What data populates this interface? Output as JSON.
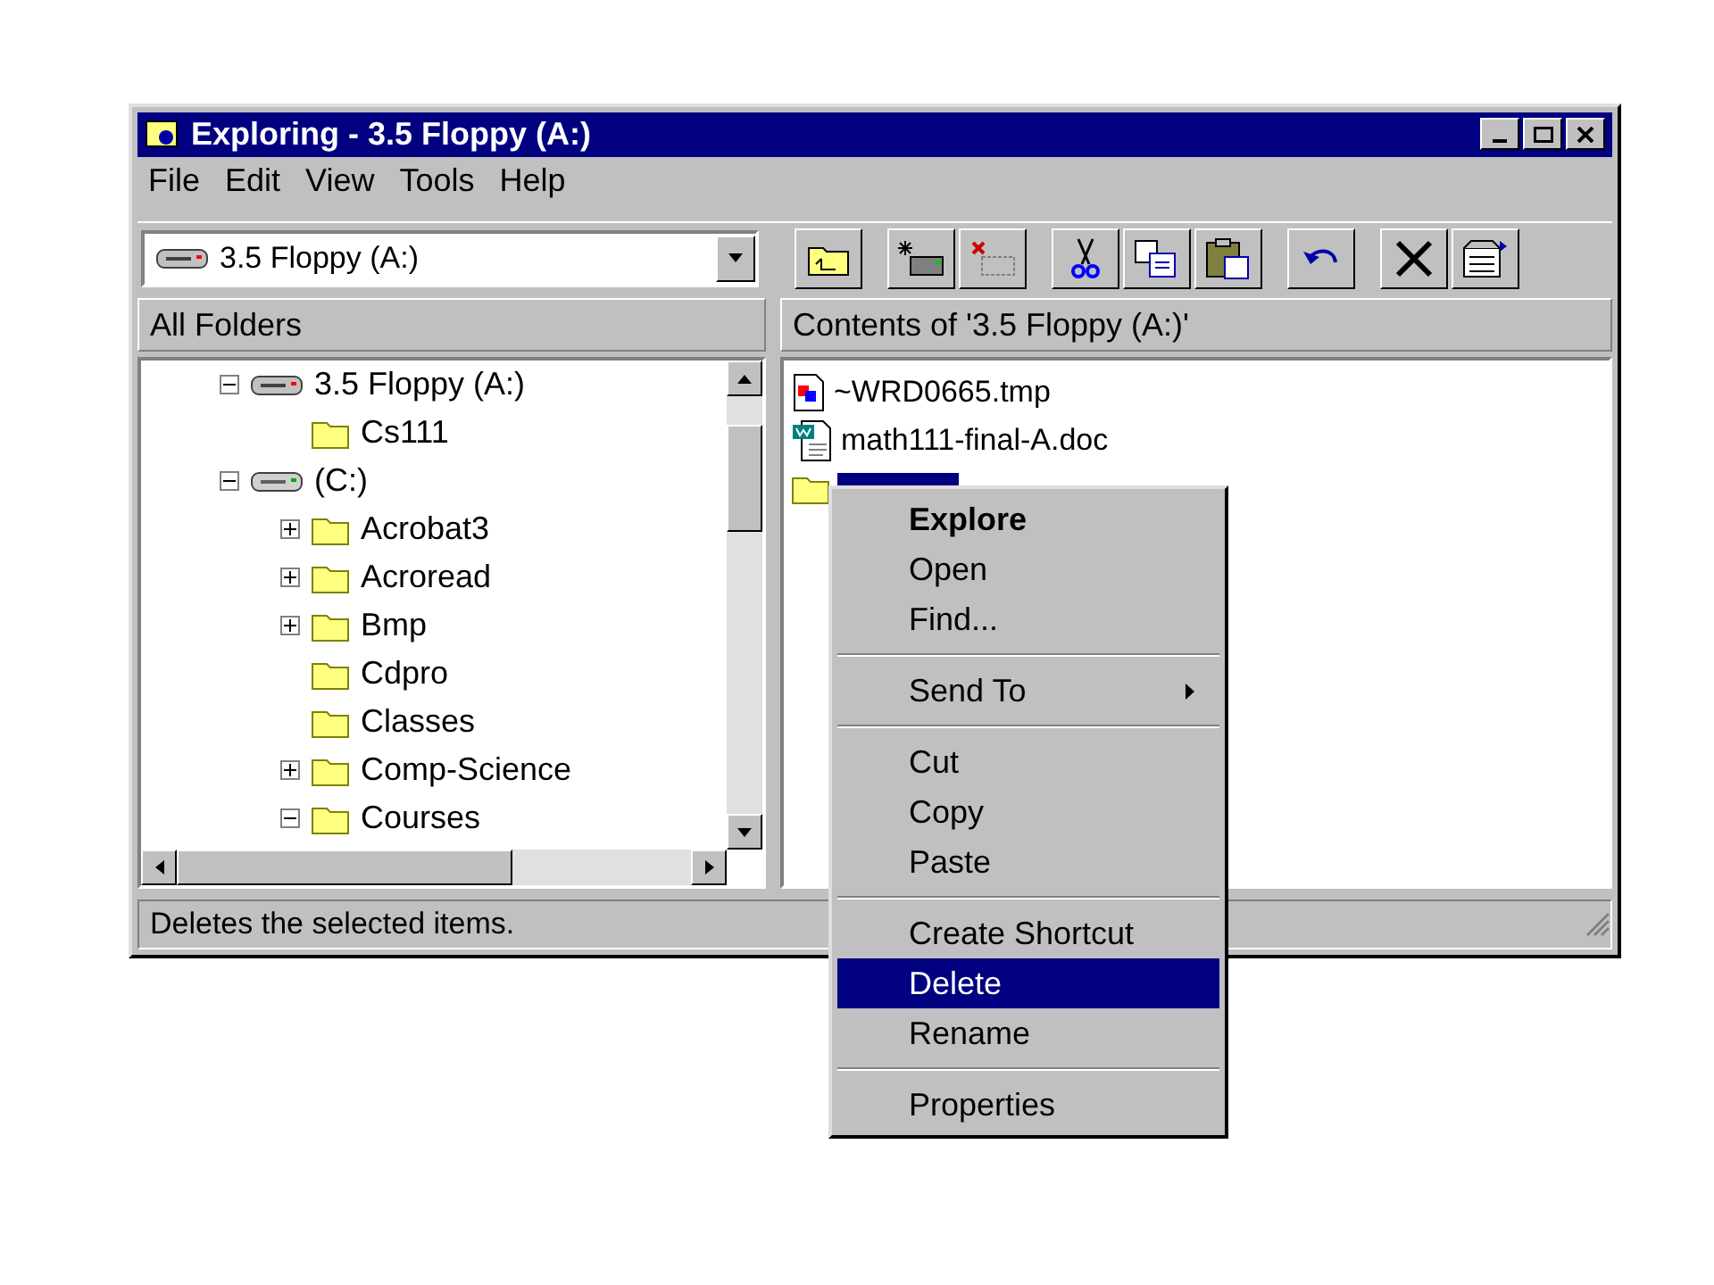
{
  "window": {
    "title": "Exploring - 3.5 Floppy (A:)"
  },
  "menu_bar": [
    "File",
    "Edit",
    "View",
    "Tools",
    "Help"
  ],
  "address": {
    "value": "3.5 Floppy (A:)"
  },
  "toolbar": [
    {
      "buttons": [
        {
          "kind": "up-folder"
        }
      ]
    },
    {
      "buttons": [
        {
          "kind": "map-drive"
        },
        {
          "kind": "disconnect"
        }
      ]
    },
    {
      "buttons": [
        {
          "kind": "cut"
        },
        {
          "kind": "copy"
        },
        {
          "kind": "paste"
        }
      ]
    },
    {
      "buttons": [
        {
          "kind": "undo"
        }
      ]
    },
    {
      "buttons": [
        {
          "kind": "delete"
        },
        {
          "kind": "properties"
        }
      ]
    }
  ],
  "left_pane": {
    "header": "All Folders",
    "tree": [
      {
        "label": "3.5 Floppy (A:)",
        "kind": "floppy",
        "has_children": true,
        "expanded": true,
        "children": [
          {
            "label": "Cs111",
            "kind": "folder",
            "has_children": false,
            "expanded": false
          }
        ]
      },
      {
        "label": "(C:)",
        "kind": "disk",
        "has_children": true,
        "expanded": true,
        "children": [
          {
            "label": "Acrobat3",
            "kind": "folder",
            "has_children": true,
            "expanded": false
          },
          {
            "label": "Acroread",
            "kind": "folder",
            "has_children": true,
            "expanded": false
          },
          {
            "label": "Bmp",
            "kind": "folder",
            "has_children": true,
            "expanded": false
          },
          {
            "label": "Cdpro",
            "kind": "folder",
            "has_children": false,
            "expanded": false
          },
          {
            "label": "Classes",
            "kind": "folder",
            "has_children": false,
            "expanded": false
          },
          {
            "label": "Comp-Science",
            "kind": "folder",
            "has_children": true,
            "expanded": false
          },
          {
            "label": "Courses",
            "kind": "folder",
            "has_children": true,
            "expanded": true
          }
        ]
      }
    ]
  },
  "right_pane": {
    "header": "Contents of '3.5 Floppy (A:)'",
    "files": [
      {
        "name": "~WRD0665.tmp",
        "kind": "tmp",
        "selected": false
      },
      {
        "name": "math111-final-A.doc",
        "kind": "doc",
        "selected": false
      },
      {
        "kind": "folder",
        "selected": true
      }
    ]
  },
  "context_menu": [
    {
      "kind": "item",
      "label": "Explore",
      "default": true,
      "submenu": false,
      "selected": false
    },
    {
      "kind": "item",
      "label": "Open",
      "default": false,
      "submenu": false,
      "selected": false
    },
    {
      "kind": "item",
      "label": "Find...",
      "default": false,
      "submenu": false,
      "selected": false
    },
    {
      "kind": "separator"
    },
    {
      "kind": "item",
      "label": "Send To",
      "default": false,
      "submenu": true,
      "selected": false
    },
    {
      "kind": "separator"
    },
    {
      "kind": "item",
      "label": "Cut",
      "default": false,
      "submenu": false,
      "selected": false
    },
    {
      "kind": "item",
      "label": "Copy",
      "default": false,
      "submenu": false,
      "selected": false
    },
    {
      "kind": "item",
      "label": "Paste",
      "default": false,
      "submenu": false,
      "selected": false
    },
    {
      "kind": "separator"
    },
    {
      "kind": "item",
      "label": "Create Shortcut",
      "default": false,
      "submenu": false,
      "selected": false
    },
    {
      "kind": "item",
      "label": "Delete",
      "default": false,
      "submenu": false,
      "selected": true
    },
    {
      "kind": "item",
      "label": "Rename",
      "default": false,
      "submenu": false,
      "selected": false
    },
    {
      "kind": "separator"
    },
    {
      "kind": "item",
      "label": "Properties",
      "default": false,
      "submenu": false,
      "selected": false
    }
  ],
  "status_bar": "Deletes the selected items."
}
